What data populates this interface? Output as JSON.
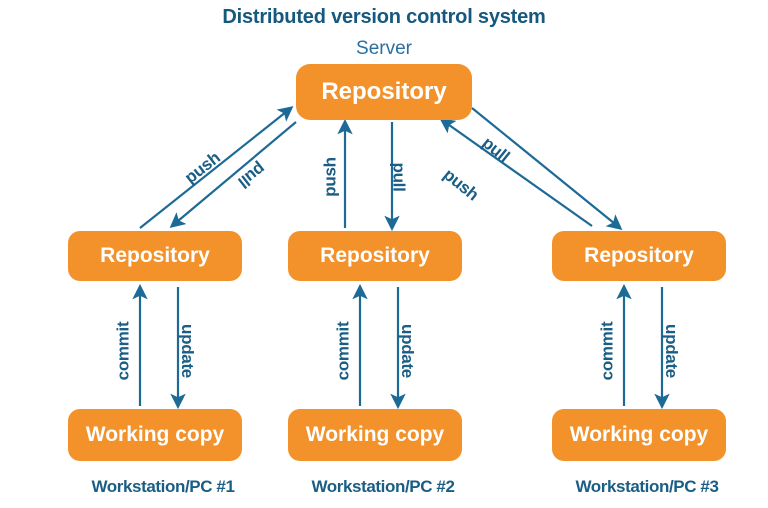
{
  "diagram": {
    "title": "Distributed version control system",
    "server_label": "Server",
    "colors": {
      "box_fill": "#f3922b",
      "box_text": "#ffffff",
      "arrow": "#1d6a96",
      "heading_text": "#15597e",
      "label_text": "#1a5e85",
      "background": "#ffffff"
    },
    "nodes": {
      "server_repository": "Repository",
      "repositories": [
        "Repository",
        "Repository",
        "Repository"
      ],
      "working_copies": [
        "Working copy",
        "Working copy",
        "Working copy"
      ],
      "workstations": [
        "Workstation/PC #1",
        "Workstation/PC #2",
        "Workstation/PC #3"
      ]
    },
    "edges": {
      "column1": {
        "to_server": "push",
        "from_server": "pull",
        "to_repository": "commit",
        "from_repository": "update"
      },
      "column2": {
        "to_server": "push",
        "from_server": "pull",
        "to_repository": "commit",
        "from_repository": "update"
      },
      "column3": {
        "to_server": "push",
        "from_server": "pull",
        "to_repository": "commit",
        "from_repository": "update"
      }
    }
  }
}
